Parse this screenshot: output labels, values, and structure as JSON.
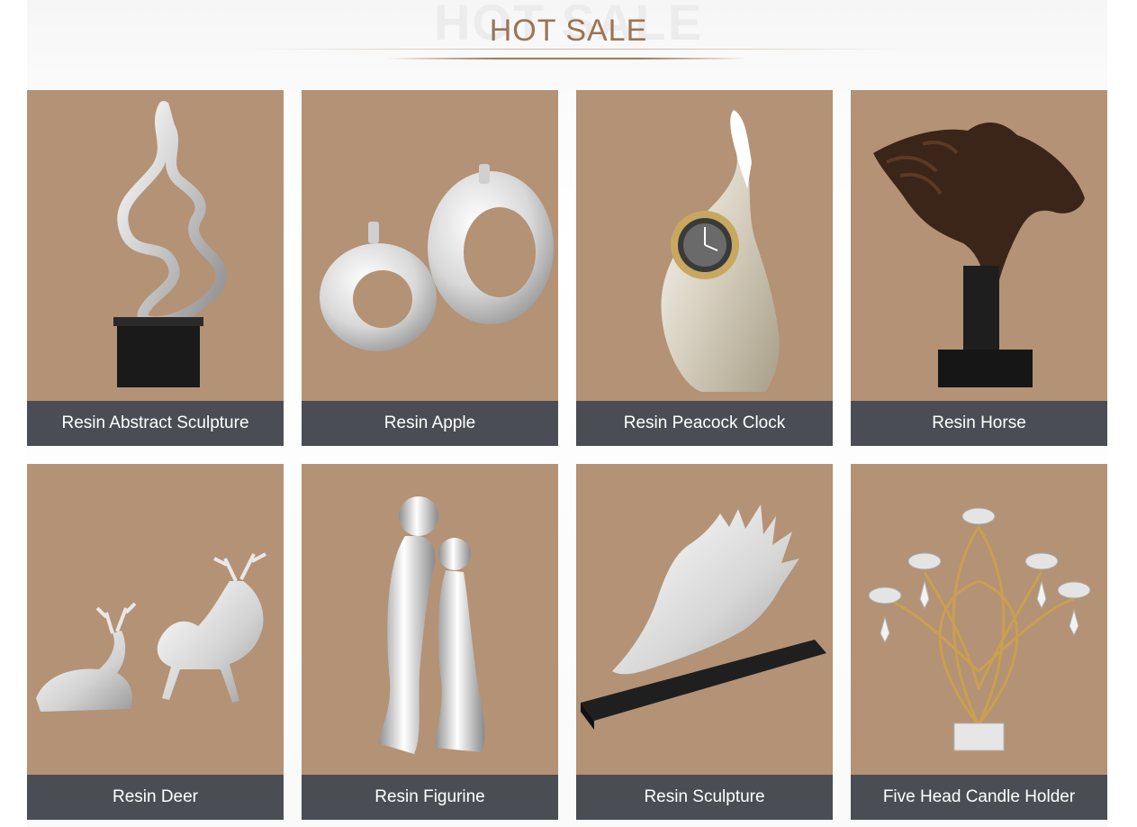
{
  "header": {
    "title": "HOT SALE",
    "title_shadow": "HOT SALE"
  },
  "colors": {
    "title": "#9a7456",
    "card_background": "#b39276",
    "caption_bar": "#4a4e54",
    "caption_text": "#ffffff"
  },
  "products": [
    {
      "name": "Resin Abstract Sculpture",
      "icon": "abstract-sculpture-icon"
    },
    {
      "name": "Resin Apple",
      "icon": "apple-icon"
    },
    {
      "name": "Resin Peacock Clock",
      "icon": "peacock-clock-icon"
    },
    {
      "name": "Resin Horse",
      "icon": "horse-icon"
    },
    {
      "name": "Resin Deer",
      "icon": "deer-icon"
    },
    {
      "name": "Resin Figurine",
      "icon": "figurine-icon"
    },
    {
      "name": "Resin Sculpture",
      "icon": "sculpture-icon"
    },
    {
      "name": "Five Head Candle Holder",
      "icon": "candle-holder-icon"
    }
  ]
}
